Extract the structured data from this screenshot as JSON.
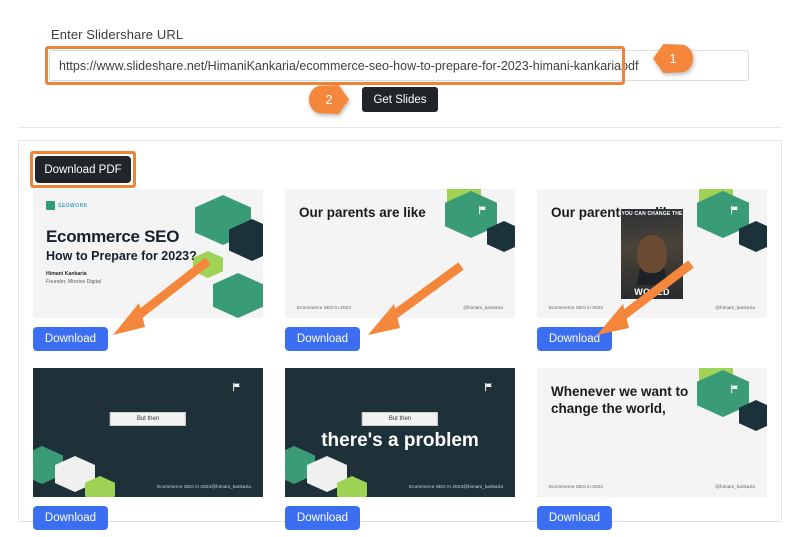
{
  "form": {
    "label": "Enter Slidershare URL",
    "url_value": "https://www.slideshare.net/HimaniKankaria/ecommerce-seo-how-to-prepare-for-2023-himani-kankariapdf",
    "url_placeholder": "Enter Slidershare URL",
    "get_slides_label": "Get Slides"
  },
  "annotations": [
    {
      "number": "1",
      "points": "left"
    },
    {
      "number": "2",
      "points": "right"
    }
  ],
  "results": {
    "download_pdf_label": "Download PDF",
    "download_label": "Download",
    "slides": [
      {
        "theme": "light",
        "logo_text": "SEOWORK",
        "heading": "Ecommerce SEO",
        "subheading": "How to Prepare for 2023?",
        "author": "Himani Kankaria",
        "author_role": "Founder, Missive Digital",
        "footer_left": "",
        "footer_right": "",
        "download_label": "Download"
      },
      {
        "theme": "light",
        "title": "Our parents are like",
        "footer_left": "Ecommerce SEO in 2023",
        "footer_right": "@himani_kankaria",
        "download_label": "Download"
      },
      {
        "theme": "light",
        "title": "Our parents are like",
        "meme_top_text": "YOU CAN CHANGE THE",
        "meme_bottom_text": "WORLD",
        "footer_left": "Ecommerce SEO in 2023",
        "footer_right": "@himani_kankaria",
        "download_label": "Download"
      },
      {
        "theme": "dark",
        "label_box": "But then",
        "footer_left": "Ecommerce SEO in 2023",
        "footer_right": "@himani_kankaria",
        "download_label": "Download"
      },
      {
        "theme": "dark",
        "label_box": "But then",
        "big_text": "there's a problem",
        "footer_left": "Ecommerce SEO in 2023",
        "footer_right": "@himani_kankaria",
        "download_label": "Download"
      },
      {
        "theme": "light",
        "title": "Whenever we want to change the world,",
        "footer_left": "Ecommerce SEO in 2023",
        "footer_right": "@himani_kankaria",
        "download_label": "Download"
      }
    ]
  },
  "colors": {
    "accent_orange": "#f08336",
    "button_dark": "#212529",
    "button_blue": "#3b6ef0",
    "slide_dark": "#1e3139",
    "green_mid": "#3a9b77",
    "green_light": "#9fd356",
    "green_pale": "#8fd06b",
    "teal_dark": "#1c323b"
  }
}
